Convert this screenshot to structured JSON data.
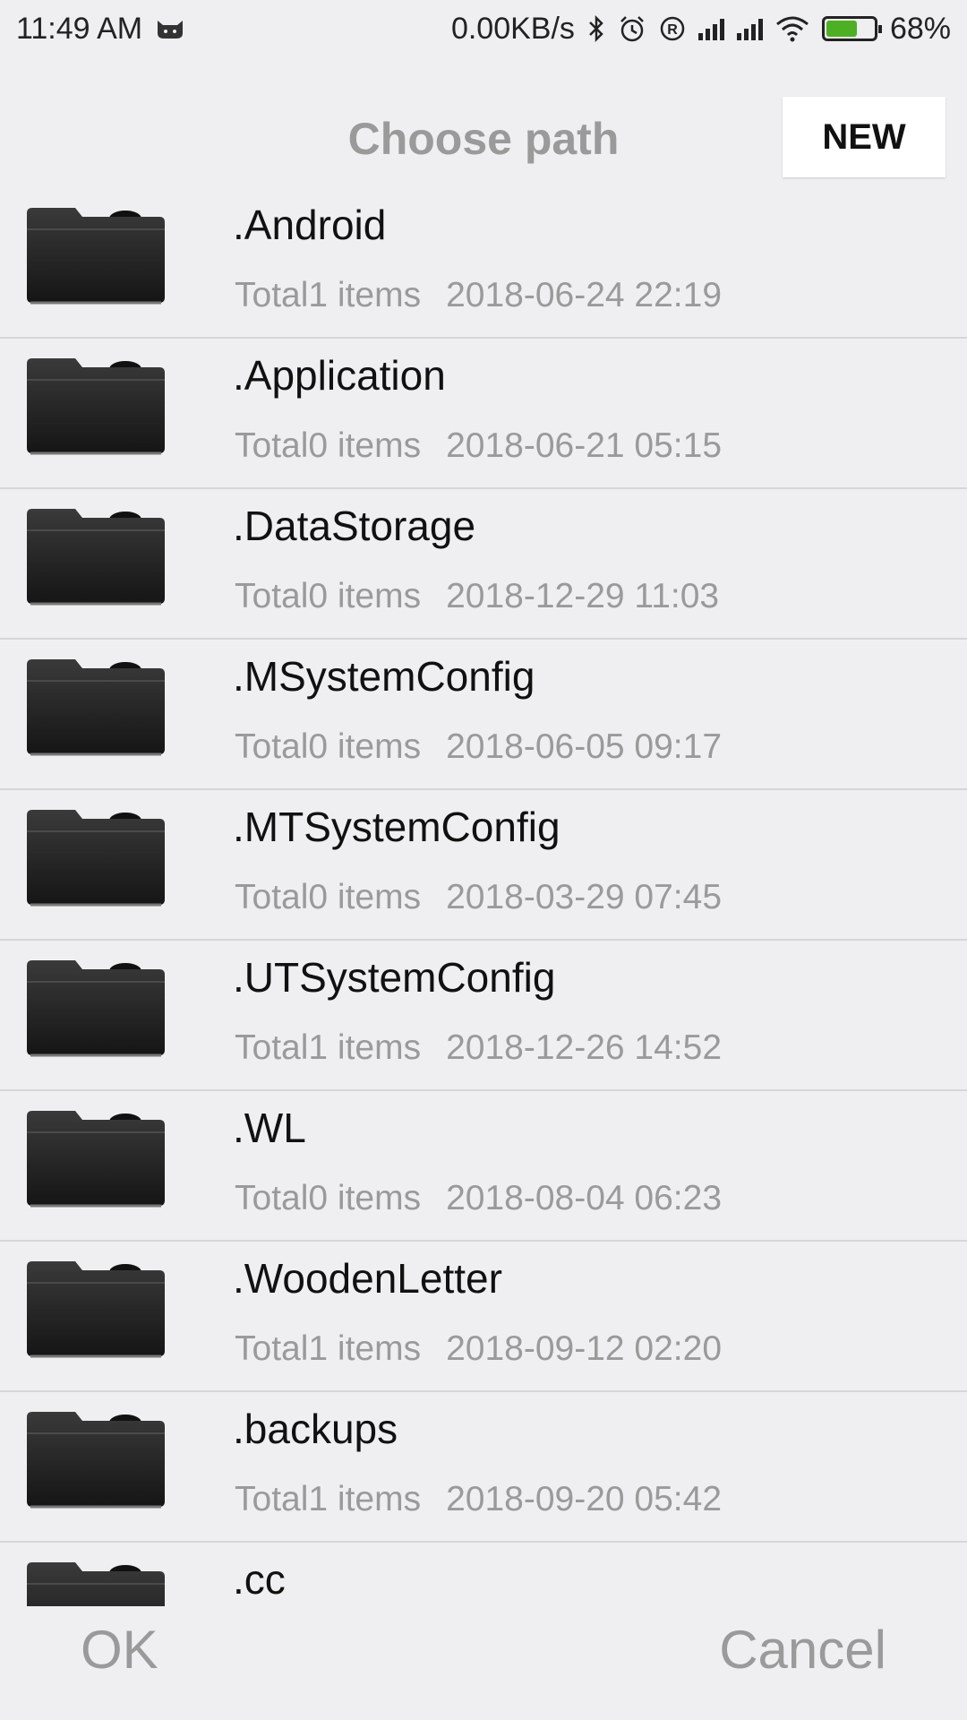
{
  "status_bar": {
    "time": "11:49  AM",
    "net_speed": "0.00KB/s",
    "battery_percent": "68%",
    "battery_level": 0.68,
    "icons": [
      "cat-icon",
      "bluetooth-icon",
      "alarm-icon",
      "registered-icon",
      "signal-icon",
      "signal-icon",
      "wifi-icon",
      "battery-charging-icon"
    ]
  },
  "dialog": {
    "title": "Choose path",
    "new_label": "NEW",
    "ok_label": "OK",
    "cancel_label": "Cancel"
  },
  "files": [
    {
      "name": ".Android",
      "count": "Total1 items",
      "date": "2018-06-24 22:19"
    },
    {
      "name": ".Application",
      "count": "Total0 items",
      "date": "2018-06-21 05:15"
    },
    {
      "name": ".DataStorage",
      "count": "Total0 items",
      "date": "2018-12-29 11:03"
    },
    {
      "name": ".MSystemConfig",
      "count": "Total0 items",
      "date": "2018-06-05 09:17"
    },
    {
      "name": ".MTSystemConfig",
      "count": "Total0 items",
      "date": "2018-03-29 07:45"
    },
    {
      "name": ".UTSystemConfig",
      "count": "Total1 items",
      "date": "2018-12-26 14:52"
    },
    {
      "name": ".WL",
      "count": "Total0 items",
      "date": "2018-08-04 06:23"
    },
    {
      "name": ".WoodenLetter",
      "count": "Total1 items",
      "date": "2018-09-12 02:20"
    },
    {
      "name": ".backups",
      "count": "Total1 items",
      "date": "2018-09-20 05:42"
    },
    {
      "name": ".cc",
      "count": "",
      "date": ""
    }
  ],
  "colors": {
    "background": "#efeff1",
    "muted_text": "#9a9a9a",
    "battery_green": "#4caf24"
  }
}
